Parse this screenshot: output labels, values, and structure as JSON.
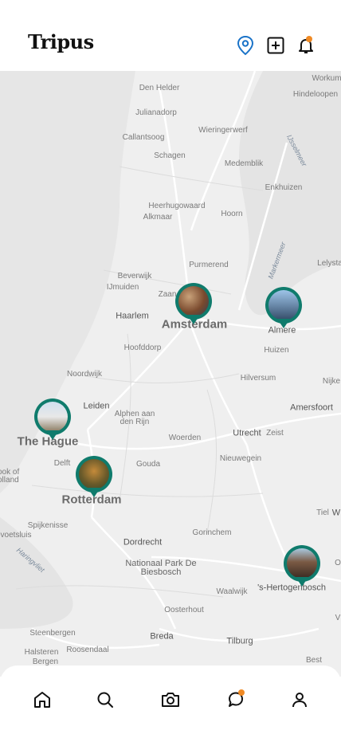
{
  "app": {
    "title": "Tripus"
  },
  "header": {
    "icons": [
      "location-pin-icon",
      "add-square-icon",
      "bell-icon"
    ],
    "notification_dot_color": "#f08a24",
    "accent": "#1a73c8"
  },
  "map": {
    "places": {
      "den_helder": "Den Helder",
      "julianadorp": "Julianadorp",
      "callantsoog": "Callantsoog",
      "schagen": "Schagen",
      "wieringerwerf": "Wieringerwerf",
      "medemblik": "Medemblik",
      "enkhuizen": "Enkhuizen",
      "ijsselmeer": "IJsselmeer",
      "workum": "Workum",
      "hindeloopen": "Hindeloopen",
      "heerhugowaard": "Heerhugowaard",
      "alkmaar": "Alkmaar",
      "hoorn": "Hoorn",
      "purmerend": "Purmerend",
      "markermeer": "Markermeer",
      "lelystad": "Lelysta",
      "beverwijk": "Beverwijk",
      "ijmuiden": "IJmuiden",
      "zaandam": "Zaan",
      "haarlem": "Haarlem",
      "amsterdam": "Amsterdam",
      "almere": "Almere",
      "hoofddorp": "Hoofddorp",
      "huizen": "Huizen",
      "noordwijk": "Noordwijk",
      "hilversum": "Hilversum",
      "nijkerk": "Nijke",
      "leiden": "Leiden",
      "alphen": "Alphen aan den Rijn",
      "amersfoort": "Amersfoort",
      "the_hague": "The Hague",
      "woerden": "Woerden",
      "utrecht": "Utrecht",
      "zeist": "Zeist",
      "delft": "Delft",
      "gouda": "Gouda",
      "nieuwegein": "Nieuwegein",
      "hoek_van_holland": "ook of olland",
      "rotterdam": "Rotterdam",
      "spijkenisse": "Spijkenisse",
      "voetsluis": "voetsluis",
      "tiel": "Tiel",
      "w": "W",
      "gorinchem": "Gorinchem",
      "haringvliet": "Haringvliet",
      "dordrecht": "Dordrecht",
      "biesbosch": "Nationaal Park De Biesbosch",
      "waalwijk": "Waalwijk",
      "hertogenbosch": "'s-Hertogenbosch",
      "o": "O",
      "oosterhout": "Oosterhout",
      "v": "V",
      "steenbergen": "Steenbergen",
      "breda": "Breda",
      "tilburg": "Tilburg",
      "halsteren": "Halsteren",
      "roosendaal": "Roosendaal",
      "bergen": "Bergen",
      "best": "Best"
    },
    "pins": [
      "amsterdam-photo-pin",
      "almere-photo-pin",
      "the-hague-photo-pin",
      "rotterdam-photo-pin",
      "hertogenbosch-photo-pin"
    ],
    "pin_color": "#0f7b6c"
  },
  "tabbar": {
    "items": [
      "home-icon",
      "search-icon",
      "camera-icon",
      "chat-icon",
      "profile-icon"
    ]
  }
}
